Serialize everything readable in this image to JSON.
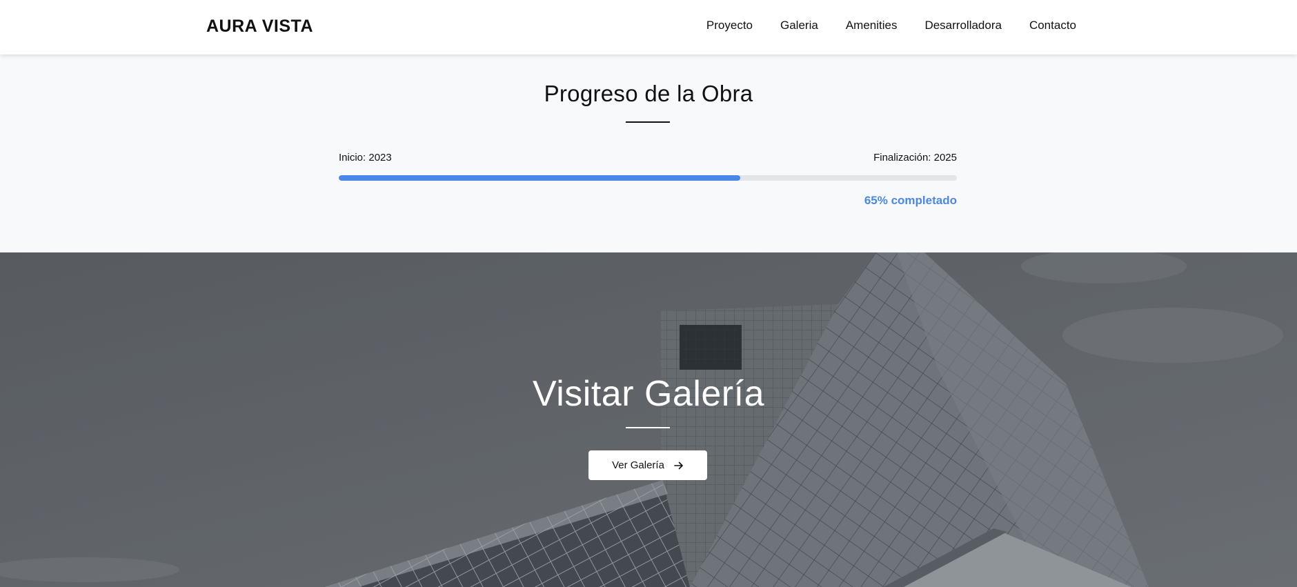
{
  "header": {
    "logo": "AURA VISTA",
    "nav": [
      "Proyecto",
      "Galeria",
      "Amenities",
      "Desarrolladora",
      "Contacto"
    ]
  },
  "progress": {
    "title": "Progreso de la Obra",
    "start_label": "Inicio: 2023",
    "end_label": "Finalización: 2025",
    "percent": 65,
    "percent_label": "65% completado",
    "accent_color": "#4a87e8"
  },
  "gallery": {
    "title": "Visitar Galería",
    "button_label": "Ver Galería",
    "button_icon": "arrow-right-icon"
  }
}
